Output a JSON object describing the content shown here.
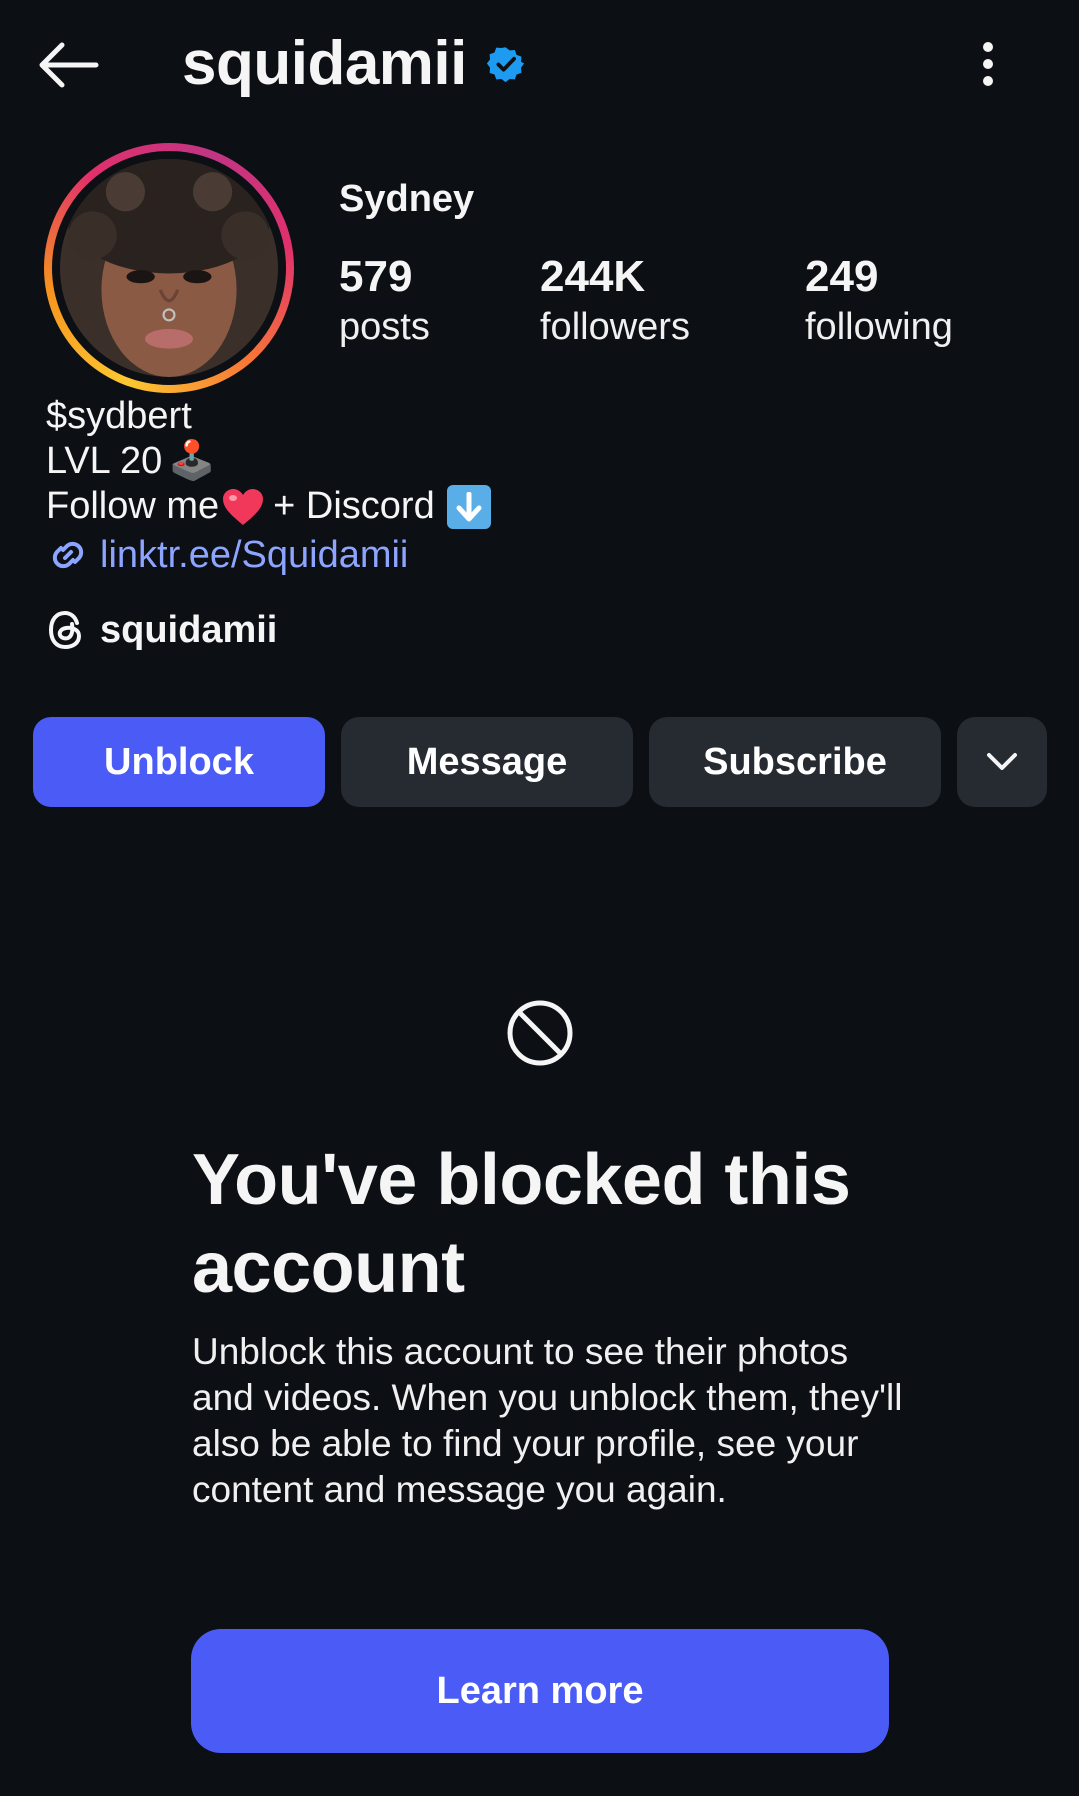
{
  "header": {
    "username": "squidamii",
    "verified": true,
    "back_icon": "arrow-left-icon",
    "more_icon": "more-vertical-icon"
  },
  "profile": {
    "display_name": "Sydney",
    "stats": [
      {
        "value": "579",
        "label": "posts"
      },
      {
        "value": "244K",
        "label": "followers"
      },
      {
        "value": "249",
        "label": "following"
      }
    ],
    "bio": {
      "line1": "$sydbert",
      "line2": "LVL 20",
      "line2_emoji": "🕹️",
      "line3_a": "Follow me",
      "line3_b": "+ Discord",
      "line3_emoji": "⬇️"
    },
    "link": "linktr.ee/Squidamii",
    "threads_handle": "squidamii"
  },
  "actions": {
    "unblock": "Unblock",
    "message": "Message",
    "subscribe": "Subscribe"
  },
  "blocked": {
    "title": "You've blocked this account",
    "body": "Unblock this account to see their photos and videos. When you unblock them, they'll also be able to find your profile, see your content and message you again.",
    "learn_more": "Learn more"
  },
  "colors": {
    "background": "#0c0f14",
    "primary": "#4a5cf5",
    "secondary": "#262a31",
    "link": "#8ea5ff",
    "verified": "#1d9bf0"
  }
}
